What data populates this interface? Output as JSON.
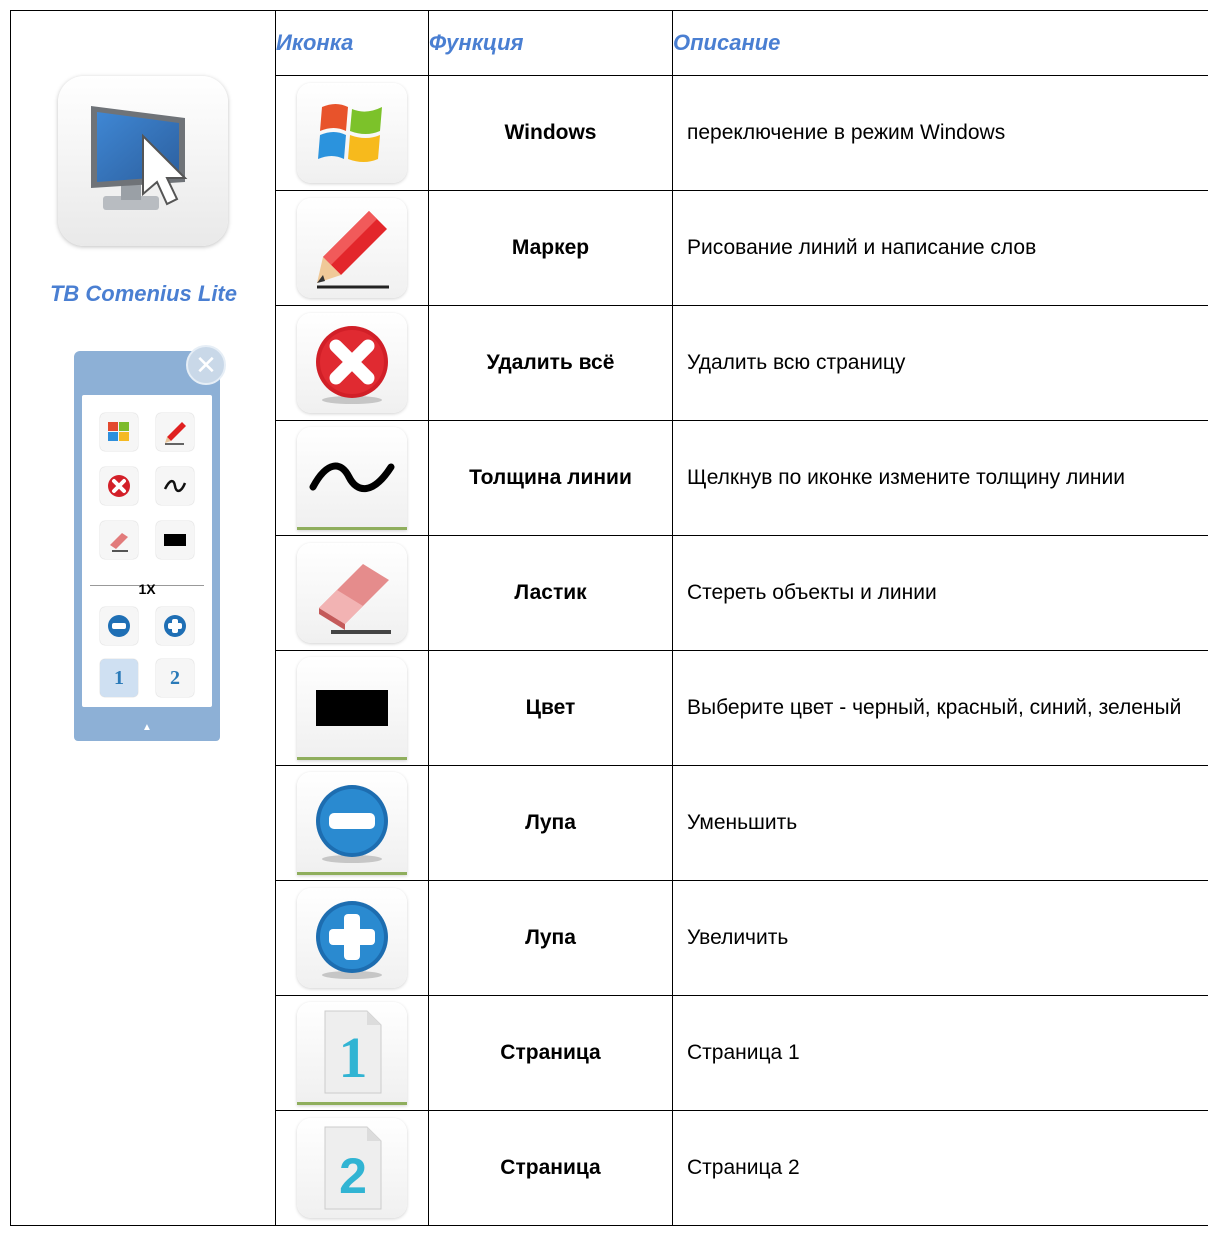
{
  "header": {
    "icon_col": "Иконка",
    "function_col": "Функция",
    "description_col": "Описание"
  },
  "left": {
    "app_name": "TB Comenius Lite",
    "zoom_label": "1X",
    "page1": "1",
    "page2": "2"
  },
  "rows": [
    {
      "icon": "windows-icon",
      "function": "Windows",
      "description": "переключение в режим Windows"
    },
    {
      "icon": "marker-icon",
      "function": "Маркер",
      "description": "Рисование линий и написание слов"
    },
    {
      "icon": "delete-all-icon",
      "function": "Удалить всё",
      "description": "Удалить всю страницу"
    },
    {
      "icon": "line-thickness-icon",
      "function": "Толщина линии",
      "description": "Щелкнув по иконке измените толщину линии"
    },
    {
      "icon": "eraser-icon",
      "function": "Ластик",
      "description": "Стереть объекты и линии"
    },
    {
      "icon": "color-icon",
      "function": "Цвет",
      "description": "Выберите цвет - черный, красный, синий, зеленый"
    },
    {
      "icon": "zoom-out-icon",
      "function": "Лупа",
      "description": "Уменьшить"
    },
    {
      "icon": "zoom-in-icon",
      "function": "Лупа",
      "description": "Увеличить"
    },
    {
      "icon": "page-1-icon",
      "function": "Страница",
      "description": "Страница 1",
      "page_number": "1"
    },
    {
      "icon": "page-2-icon",
      "function": "Страница",
      "description": "Страница 2",
      "page_number": "2"
    }
  ]
}
